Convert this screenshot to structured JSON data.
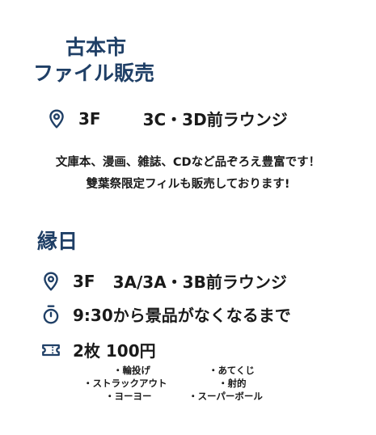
{
  "section1": {
    "title_line1": "古本市",
    "title_line2": "ファイル販売",
    "location_floor": "3F",
    "location_place": "3C・3D前ラウンジ",
    "description_line1": "文庫本、漫画、雑誌、CDなど品ぞろえ豊富です！",
    "description_line2": "雙葉祭限定フィルも販売しております!"
  },
  "section2": {
    "title": "縁日",
    "location_floor": "3F",
    "location_place": "3A/3A・3B前ラウンジ",
    "time_text": "9:30から景品がなくなるまで",
    "ticket_text": "2枚 100円",
    "games_left": [
      "・輪投げ",
      "・ストラックアウト",
      "・ヨーヨー"
    ],
    "games_right": [
      "・あてくじ",
      "・射的",
      "・スーパーボール"
    ]
  },
  "colors": {
    "title": "#1f3f66",
    "icon": "#1f3f66",
    "text": "#1a1a1a"
  },
  "icons": [
    "location-pin-icon",
    "stopwatch-icon",
    "ticket-icon"
  ]
}
